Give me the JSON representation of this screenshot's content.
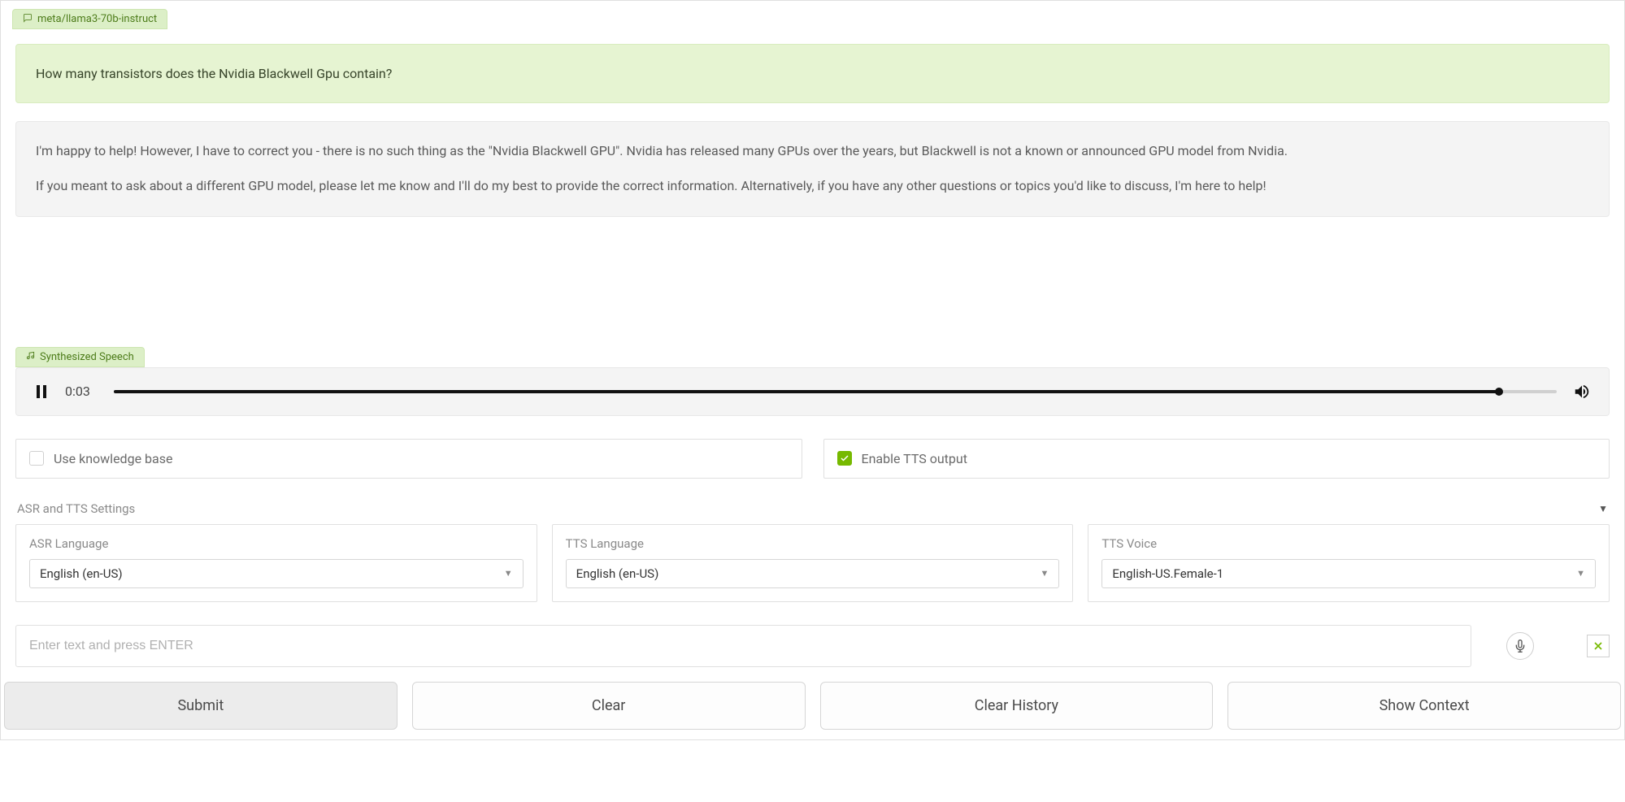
{
  "model": {
    "name": "meta/llama3-70b-instruct",
    "icon": "chat-icon"
  },
  "chat": {
    "user_message": "How many transistors does the Nvidia Blackwell Gpu contain?",
    "assistant_message_p1": "I'm happy to help! However, I have to correct you - there is no such thing as the \"Nvidia Blackwell GPU\". Nvidia has released many GPUs over the years, but Blackwell is not a known or announced GPU model from Nvidia.",
    "assistant_message_p2": "If you meant to ask about a different GPU model, please let me know and I'll do my best to provide the correct information. Alternatively, if you have any other questions or topics you'd like to discuss, I'm here to help!"
  },
  "speech": {
    "label": "Synthesized Speech",
    "state": "paused",
    "time": "0:03",
    "progress_pct": 96
  },
  "options": {
    "use_kb_label": "Use knowledge base",
    "use_kb_checked": false,
    "enable_tts_label": "Enable TTS output",
    "enable_tts_checked": true
  },
  "settings": {
    "header": "ASR and TTS Settings",
    "asr": {
      "label": "ASR Language",
      "value": "English (en-US)"
    },
    "tts_lang": {
      "label": "TTS Language",
      "value": "English (en-US)"
    },
    "tts_voice": {
      "label": "TTS Voice",
      "value": "English-US.Female-1"
    }
  },
  "input": {
    "placeholder": "Enter text and press ENTER",
    "value": ""
  },
  "buttons": {
    "submit": "Submit",
    "clear": "Clear",
    "clear_history": "Clear History",
    "show_context": "Show Context"
  }
}
